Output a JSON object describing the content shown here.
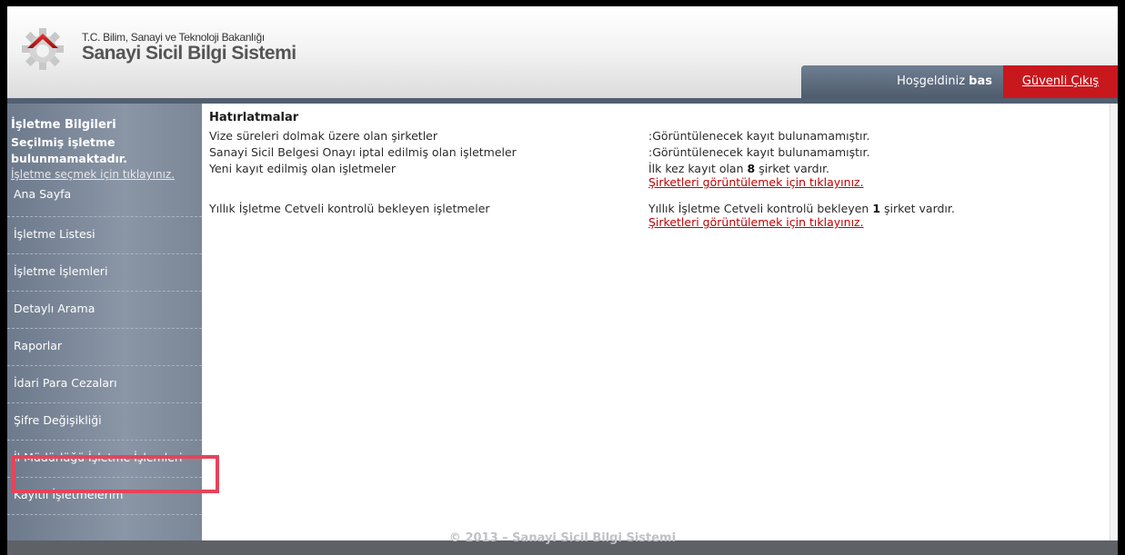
{
  "header": {
    "ministry": "T.C. Bilim, Sanayi ve Teknoloji Bakanlığı",
    "system_title": "Sanayi Sicil Bilgi Sistemi",
    "welcome_label": "Hoşgeldiniz",
    "username": "bas",
    "logout_label": "Güvenli Çıkış",
    "logo_icon": "gear-icon"
  },
  "sidebar": {
    "title": "İşletme Bilgileri",
    "selected_status": "Seçilmiş işletme bulunmamaktadır.",
    "select_link": "İşletme seçmek için tıklayınız.",
    "items": [
      {
        "label": "Ana Sayfa"
      },
      {
        "label": "İşletme Listesi"
      },
      {
        "label": "İşletme İşlemleri"
      },
      {
        "label": "Detaylı Arama"
      },
      {
        "label": "Raporlar"
      },
      {
        "label": "İdari Para Cezaları"
      },
      {
        "label": "Şifre Değişikliği"
      },
      {
        "label": "İl Müdürlüğü İşletme İşlemleri"
      },
      {
        "label": "Kayıtlı İşletmelerim"
      }
    ]
  },
  "main": {
    "title": "Hatırlatmalar",
    "rows": [
      {
        "label": "Vize süreleri dolmak üzere olan şirketler",
        "value": ":Görüntülenecek kayıt bulunamamıştır."
      },
      {
        "label": "Sanayi Sicil Belgesi Onayı iptal edilmiş olan işletmeler",
        "value": ":Görüntülenecek kayıt bulunamamıştır."
      },
      {
        "label": "Yeni kayıt edilmiş olan işletmeler",
        "value_prefix": "İlk kez kayıt olan",
        "count": "8",
        "value_suffix": "şirket vardır.",
        "link": "Şirketleri görüntülemek için tıklayınız."
      },
      {
        "label": "Yıllık İşletme Cetveli kontrolü bekleyen işletmeler",
        "value_prefix": "Yıllık İşletme Cetveli kontrolü bekleyen",
        "count": "1",
        "value_suffix": "şirket vardır.",
        "link": "Şirketleri görüntülemek için tıklayınız."
      }
    ]
  },
  "footer": {
    "text": "© 2013 – Sanayi Sicil Bilgi Sistemi"
  },
  "colors": {
    "logout_bg": "#c9171e",
    "sidebar_bg": "#7b8797",
    "link": "#c00000",
    "highlight": "#e4445a"
  }
}
